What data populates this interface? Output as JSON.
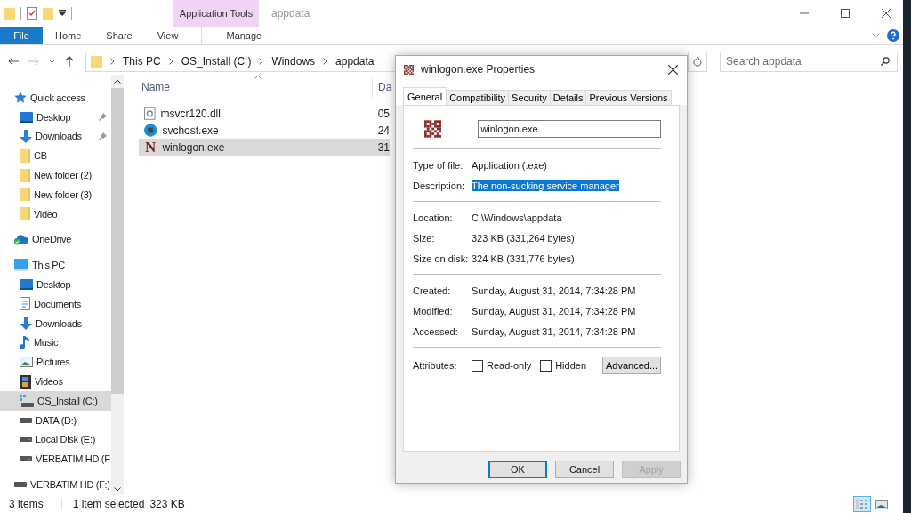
{
  "window": {
    "title": "appdata",
    "context_tab_group": "Application Tools"
  },
  "ribbon_tabs": [
    {
      "label": "File",
      "kind": "file",
      "selected": false
    },
    {
      "label": "Home",
      "kind": "tab",
      "selected": false
    },
    {
      "label": "Share",
      "kind": "tab",
      "selected": false
    },
    {
      "label": "View",
      "kind": "tab",
      "selected": false
    },
    {
      "label": "Manage",
      "kind": "context",
      "selected": false
    }
  ],
  "address_bar": {
    "segments": [
      "This PC",
      "OS_Install (C:)",
      "Windows",
      "appdata"
    ]
  },
  "search": {
    "placeholder": "Search appdata"
  },
  "sidebar": {
    "items": [
      {
        "label": "Quick access",
        "kind": "star",
        "pinned": false,
        "selected": false,
        "children": [
          {
            "label": "Desktop",
            "kind": "desktop",
            "pinned": true,
            "selected": false
          },
          {
            "label": "Downloads",
            "kind": "download",
            "pinned": true,
            "selected": false
          },
          {
            "label": "CB",
            "kind": "folder",
            "pinned": false,
            "selected": false
          },
          {
            "label": "New folder (2)",
            "kind": "folder",
            "pinned": false,
            "selected": false
          },
          {
            "label": "New folder (3)",
            "kind": "folder",
            "pinned": false,
            "selected": false
          },
          {
            "label": "Video",
            "kind": "folder",
            "pinned": false,
            "selected": false
          }
        ]
      },
      {
        "label": "OneDrive",
        "kind": "cloud",
        "pinned": false,
        "selected": false
      },
      {
        "label": "This PC",
        "kind": "pc",
        "pinned": false,
        "selected": false,
        "children": [
          {
            "label": "Desktop",
            "kind": "desktop",
            "pinned": false,
            "selected": false
          },
          {
            "label": "Documents",
            "kind": "documents",
            "pinned": false,
            "selected": false
          },
          {
            "label": "Downloads",
            "kind": "download",
            "pinned": false,
            "selected": false
          },
          {
            "label": "Music",
            "kind": "music",
            "pinned": false,
            "selected": false
          },
          {
            "label": "Pictures",
            "kind": "pictures",
            "pinned": false,
            "selected": false
          },
          {
            "label": "Videos",
            "kind": "videos",
            "pinned": false,
            "selected": false
          },
          {
            "label": "OS_Install (C:)",
            "kind": "osdrive",
            "pinned": false,
            "selected": true
          },
          {
            "label": "DATA (D:)",
            "kind": "drive",
            "pinned": false,
            "selected": false
          },
          {
            "label": "Local Disk (E:)",
            "kind": "drive",
            "pinned": false,
            "selected": false
          },
          {
            "label": "VERBATIM HD (F",
            "kind": "drive",
            "pinned": false,
            "selected": false
          }
        ]
      },
      {
        "label": "VERBATIM HD (F:)",
        "kind": "drive",
        "pinned": false,
        "selected": false
      }
    ]
  },
  "file_list": {
    "columns": [
      "Name",
      "Da"
    ],
    "rows": [
      {
        "name": "msvcr120.dll",
        "column_2": "05",
        "kind": "dll",
        "selected": false
      },
      {
        "name": "svchost.exe",
        "column_2": "24",
        "kind": "service",
        "selected": false
      },
      {
        "name": "winlogon.exe",
        "column_2": "31",
        "kind": "app",
        "glyph": "N",
        "selected": true
      }
    ]
  },
  "status_bar": {
    "count": "3 items",
    "selection": "1 item selected",
    "size": "323 KB"
  },
  "dialog": {
    "title": "winlogon.exe Properties",
    "tabs": [
      {
        "label": "General",
        "selected": true
      },
      {
        "label": "Compatibility",
        "selected": false
      },
      {
        "label": "Security",
        "selected": false
      },
      {
        "label": "Details",
        "selected": false
      },
      {
        "label": "Previous Versions",
        "selected": false
      }
    ],
    "file_name": "winlogon.exe",
    "groups": [
      [
        {
          "label": "Type of file:",
          "value": "Application (.exe)",
          "highlighted": false
        },
        {
          "label": "Description:",
          "value": "The non-sucking service manager",
          "highlighted": true
        }
      ],
      [
        {
          "label": "Location:",
          "value": "C:\\Windows\\appdata",
          "highlighted": false
        },
        {
          "label": "Size:",
          "value": "323 KB (331,264 bytes)",
          "highlighted": false
        },
        {
          "label": "Size on disk:",
          "value": "324 KB (331,776 bytes)",
          "highlighted": false
        }
      ],
      [
        {
          "label": "Created:",
          "value": "Sunday, August 31, 2014, 7:34:28 PM",
          "highlighted": false
        },
        {
          "label": "Modified:",
          "value": "Sunday, August 31, 2014, 7:34:28 PM",
          "highlighted": false
        },
        {
          "label": "Accessed:",
          "value": "Sunday, August 31, 2014, 7:34:28 PM",
          "highlighted": false
        }
      ]
    ],
    "attributes_label": "Attributes:",
    "attributes": [
      {
        "label": "Read-only",
        "checked": false
      },
      {
        "label": "Hidden",
        "checked": false
      }
    ],
    "advanced_button": "Advanced...",
    "buttons": [
      {
        "label": "OK",
        "default": true,
        "disabled": false
      },
      {
        "label": "Cancel",
        "default": false,
        "disabled": false
      },
      {
        "label": "Apply",
        "default": false,
        "disabled": true
      }
    ]
  }
}
